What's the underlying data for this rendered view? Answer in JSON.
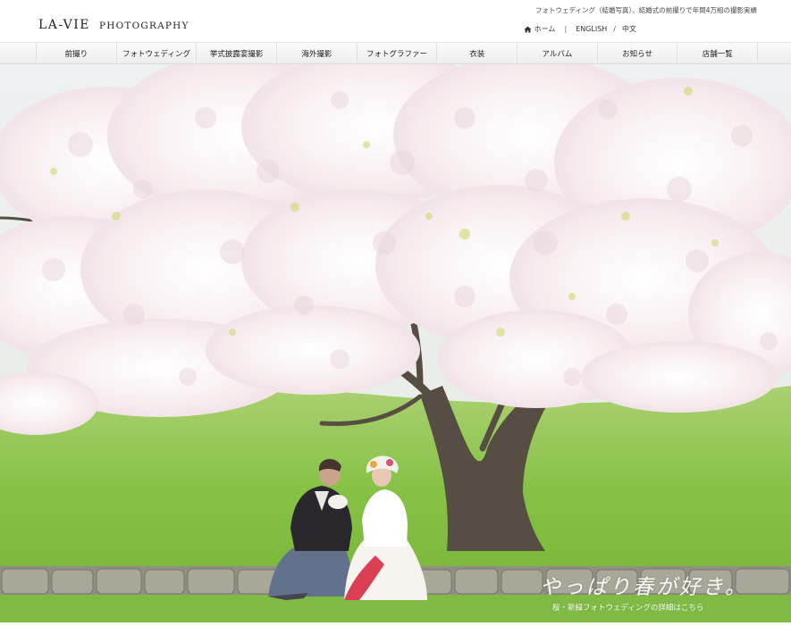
{
  "brand": {
    "logo_main": "LA-VIE",
    "logo_sub": "PHOTOGRAPHY"
  },
  "header": {
    "tagline": "フォトウェディング（結婚写真）、結婚式の前撮りで年間4万組の撮影実績",
    "utility": {
      "home": "ホーム",
      "separator": "|",
      "english": "ENGLISH",
      "slash": "/",
      "chinese": "中文"
    }
  },
  "nav": {
    "items": [
      {
        "label": "前撮り"
      },
      {
        "label": "フォトウェディング"
      },
      {
        "label": "挙式披露宴撮影"
      },
      {
        "label": "海外撮影"
      },
      {
        "label": "フォトグラファー"
      },
      {
        "label": "衣装"
      },
      {
        "label": "アルバム"
      },
      {
        "label": "お知らせ"
      },
      {
        "label": "店舗一覧"
      }
    ]
  },
  "hero": {
    "caption_main": "やっぱり春が好き。",
    "caption_sub": "桜・新緑フォトウェディングの詳細はこちら"
  },
  "icons": {
    "home": "home-icon"
  },
  "colors": {
    "grass": "#7cc13a",
    "blossom": "#f7ecee",
    "trunk": "#4d4538",
    "hakama": "#5c6a86"
  }
}
